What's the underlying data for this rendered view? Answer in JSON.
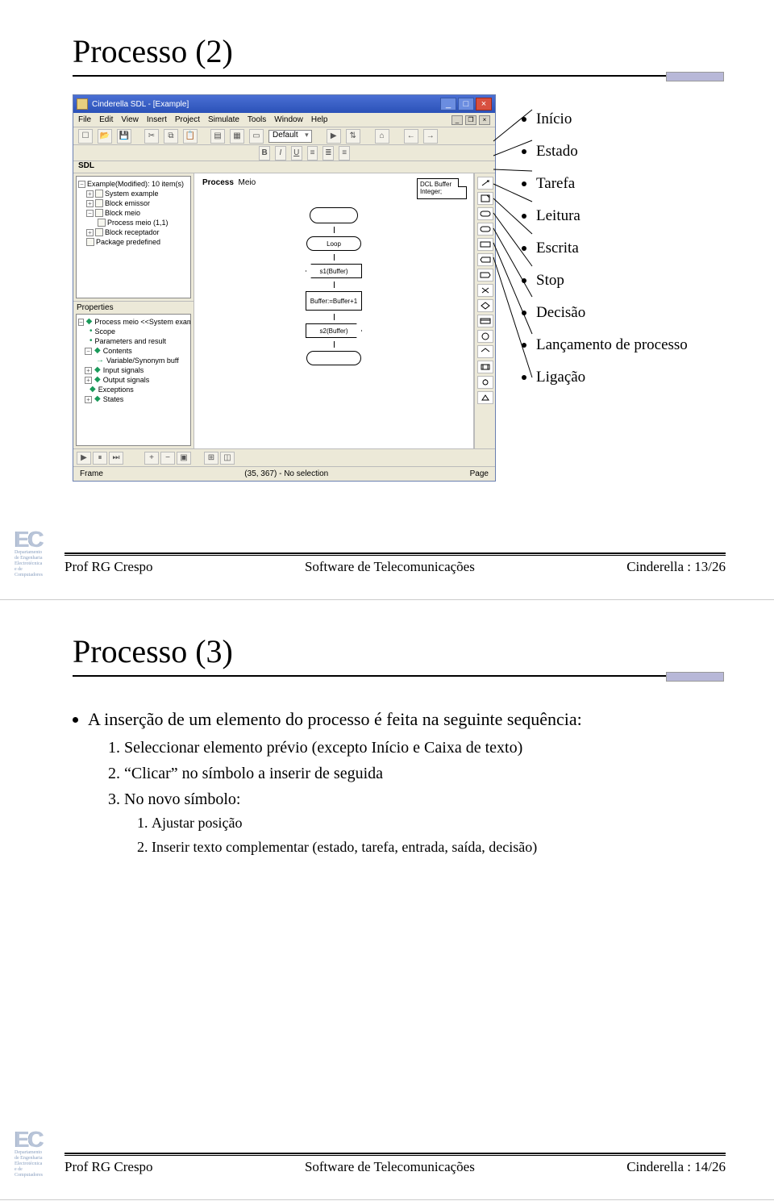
{
  "slide1": {
    "title": "Processo (2)",
    "callouts": [
      "Início",
      "Estado",
      "Tarefa",
      "Leitura",
      "Escrita",
      "Stop",
      "Decisão",
      "Lançamento de processo",
      "Ligação"
    ],
    "app": {
      "window_title": "Cinderella SDL - [Example]",
      "menus": [
        "File",
        "Edit",
        "View",
        "Insert",
        "Project",
        "Simulate",
        "Tools",
        "Window",
        "Help"
      ],
      "toolbar_combo": "Default",
      "sdl_label": "SDL",
      "tree_header": "Example(Modified): 10 item(s)",
      "tree_items": [
        "System example",
        "Block emissor",
        "Block meio",
        "Process meio (1,1)",
        "Block receptador",
        "Package predefined"
      ],
      "properties_label": "Properties",
      "properties_top": "Process meio <<System exam",
      "properties_items": [
        "Scope",
        "Parameters and result",
        "Contents",
        "Variable/Synonym buff",
        "Input signals",
        "Output signals",
        "Exceptions",
        "States"
      ],
      "canvas": {
        "header": "Process",
        "header_val": "Meio",
        "dcl1": "DCL Buffer",
        "dcl2": "Integer;",
        "state1": "Loop",
        "in1": "s1(Buffer)",
        "task1": "Buffer:=",
        "task2": "Buffer+1",
        "out1": "s2(Buffer)"
      },
      "status_left": "Frame",
      "status_mid": "(35, 367) - No selection",
      "status_right": "Page"
    }
  },
  "slide2": {
    "title": "Processo (3)",
    "bullet": "A inserção de um elemento do processo é feita na seguinte sequência:",
    "steps": [
      "Seleccionar elemento prévio (excepto Início e Caixa de texto)",
      "“Clicar” no símbolo a inserir de seguida",
      "No novo símbolo:"
    ],
    "substeps": [
      "Ajustar posição",
      "Inserir texto complementar (estado, tarefa, entrada, saída, decisão)"
    ]
  },
  "footer": {
    "left": "Prof RG Crespo",
    "center": "Software de Telecomunicações",
    "right_prefix": "Cinderella : ",
    "page1": "13/26",
    "page2": "14/26"
  },
  "logo": {
    "big": "EC",
    "l1": "Departamento",
    "l2": "de Engenharia",
    "l3": "Electrotécnica",
    "l4": "e de",
    "l5": "Computadores"
  }
}
